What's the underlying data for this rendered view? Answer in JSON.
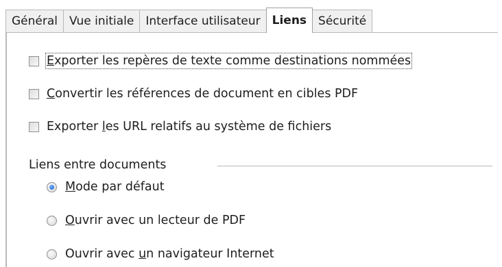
{
  "tabs": [
    {
      "label": "Général",
      "active": false
    },
    {
      "label": "Vue initiale",
      "active": false
    },
    {
      "label": "Interface utilisateur",
      "active": false
    },
    {
      "label": "Liens",
      "active": true
    },
    {
      "label": "Sécurité",
      "active": false
    }
  ],
  "checkboxes": {
    "export_bookmarks": {
      "pre": "",
      "ul": "E",
      "post": "xporter les repères de texte comme destinations nommées",
      "checked": false
    },
    "convert_refs": {
      "pre": "",
      "ul": "C",
      "post": "onvertir les références de document en cibles PDF",
      "checked": false
    },
    "relative_urls": {
      "pre": "Exporter ",
      "ul": "l",
      "post": "es URL relatifs au système de fichiers",
      "checked": false
    }
  },
  "group": {
    "label": "Liens entre documents",
    "options": [
      {
        "pre": "",
        "ul": "M",
        "post": "ode par défaut",
        "checked": true
      },
      {
        "pre": "",
        "ul": "O",
        "post": "uvrir avec un lecteur de PDF",
        "checked": false
      },
      {
        "pre": "Ouvrir avec ",
        "ul": "u",
        "post": "n navigateur Internet",
        "checked": false
      }
    ]
  },
  "colors": {
    "accent": "#1d5fc9",
    "border": "#b8b8b8",
    "tab_bg": "#f0f0f0"
  }
}
